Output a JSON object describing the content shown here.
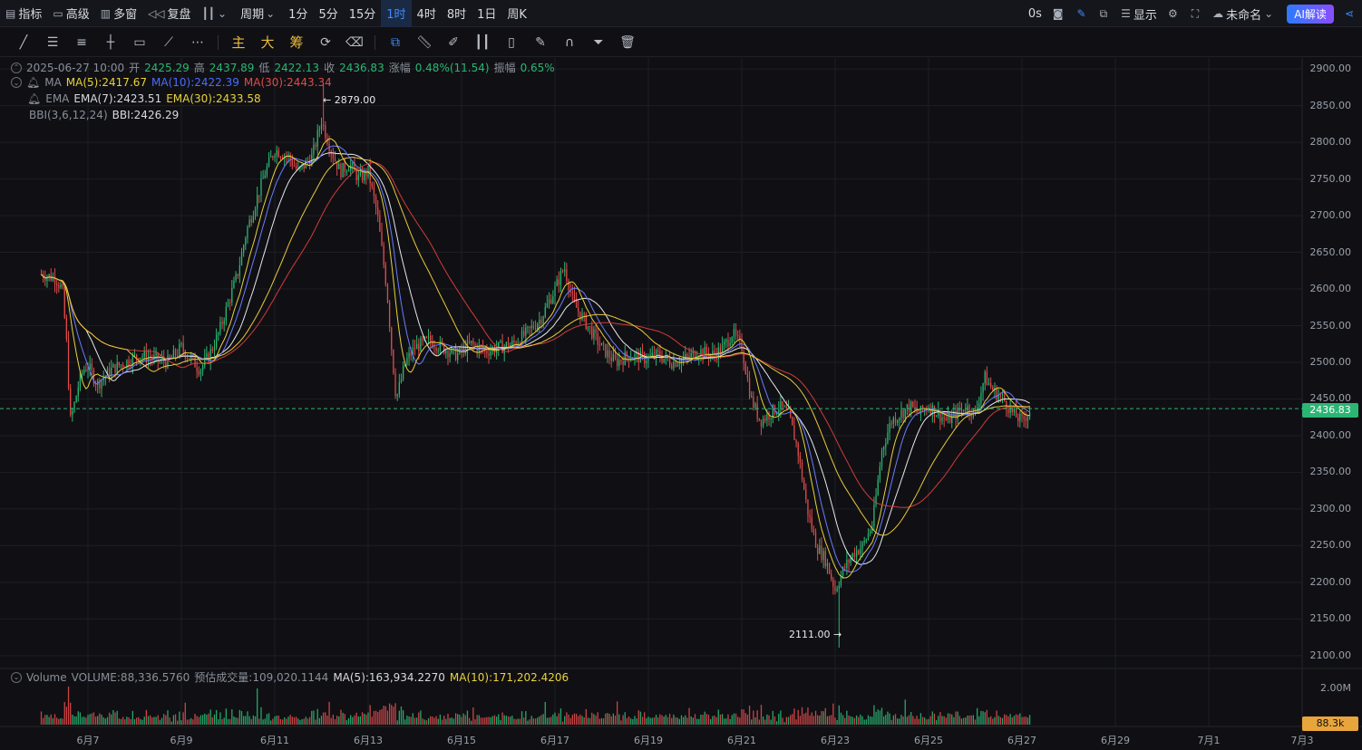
{
  "topbar": {
    "indicators": "指标",
    "advanced": "高级",
    "multiwindow": "多窗",
    "replay": "复盘",
    "period": "周期",
    "intervals": [
      "1分",
      "5分",
      "15分",
      "1时",
      "4时",
      "8时",
      "1日",
      "周K"
    ],
    "active_interval": "1时",
    "latency": "0s",
    "display": "显示",
    "layout_name": "未命名",
    "ai": "AI解读"
  },
  "drawing_tools": {
    "main": "主",
    "big": "大",
    "chip": "筹"
  },
  "ohlc": {
    "datetime": "2025-06-27 10:00",
    "open_label": "开",
    "open": "2425.29",
    "high_label": "高",
    "high": "2437.89",
    "low_label": "低",
    "low": "2422.13",
    "close_label": "收",
    "close": "2436.83",
    "change_label": "涨幅",
    "change": "0.48%(11.54)",
    "amp_label": "振幅",
    "amp": "0.65%"
  },
  "ma": {
    "name": "MA",
    "ma5": "MA(5):2417.67",
    "ma10": "MA(10):2422.39",
    "ma30": "MA(30):2443.34"
  },
  "ema": {
    "name": "EMA",
    "ema7": "EMA(7):2423.51",
    "ema30": "EMA(30):2433.58"
  },
  "bbi": {
    "name": "BBI(3,6,12,24)",
    "value": "BBI:2426.29"
  },
  "volume": {
    "name": "Volume",
    "vol": "VOLUME:88,336.5760",
    "est": "预估成交量:109,020.1144",
    "ma5": "MA(5):163,934.2270",
    "ma10": "MA(10):171,202.4206",
    "axis_top": "2.00M",
    "current": "88.3k"
  },
  "annotations": {
    "high": "← 2879.00",
    "low": "2111.00 →"
  },
  "current_price": "2436.83",
  "chart_data": {
    "type": "candlestick",
    "y_ticks": [
      "2900.00",
      "2850.00",
      "2800.00",
      "2750.00",
      "2700.00",
      "2650.00",
      "2600.00",
      "2550.00",
      "2500.00",
      "2450.00",
      "2400.00",
      "2350.00",
      "2300.00",
      "2250.00",
      "2200.00",
      "2150.00",
      "2100.00"
    ],
    "ylim": [
      2085,
      2915
    ],
    "x_ticks": [
      "6月7",
      "6月9",
      "6月11",
      "6月13",
      "6月15",
      "6月17",
      "6月19",
      "6月21",
      "6月23",
      "6月25",
      "6月27",
      "6月29",
      "7月1",
      "7月3"
    ],
    "x_range_days": [
      6.0,
      7.6
    ],
    "close_path": [
      [
        6.0,
        2620
      ],
      [
        6.3,
        2615
      ],
      [
        6.45,
        2600
      ],
      [
        6.55,
        2520
      ],
      [
        6.62,
        2420
      ],
      [
        6.7,
        2440
      ],
      [
        6.8,
        2470
      ],
      [
        6.9,
        2490
      ],
      [
        7.0,
        2495
      ],
      [
        7.2,
        2470
      ],
      [
        7.5,
        2490
      ],
      [
        7.8,
        2500
      ],
      [
        8.1,
        2510
      ],
      [
        8.4,
        2505
      ],
      [
        8.7,
        2500
      ],
      [
        9.0,
        2520
      ],
      [
        9.2,
        2505
      ],
      [
        9.4,
        2490
      ],
      [
        9.6,
        2510
      ],
      [
        9.8,
        2540
      ],
      [
        10.0,
        2580
      ],
      [
        10.2,
        2620
      ],
      [
        10.4,
        2680
      ],
      [
        10.6,
        2720
      ],
      [
        10.8,
        2760
      ],
      [
        11.0,
        2790
      ],
      [
        11.3,
        2780
      ],
      [
        11.5,
        2760
      ],
      [
        11.8,
        2780
      ],
      [
        12.0,
        2830
      ],
      [
        12.2,
        2790
      ],
      [
        12.4,
        2760
      ],
      [
        12.6,
        2770
      ],
      [
        12.8,
        2750
      ],
      [
        13.0,
        2760
      ],
      [
        13.2,
        2700
      ],
      [
        13.4,
        2600
      ],
      [
        13.5,
        2520
      ],
      [
        13.6,
        2450
      ],
      [
        13.8,
        2500
      ],
      [
        14.0,
        2520
      ],
      [
        14.3,
        2530
      ],
      [
        14.6,
        2520
      ],
      [
        14.9,
        2510
      ],
      [
        15.2,
        2525
      ],
      [
        15.5,
        2515
      ],
      [
        15.8,
        2520
      ],
      [
        16.1,
        2525
      ],
      [
        16.4,
        2540
      ],
      [
        16.7,
        2560
      ],
      [
        17.0,
        2600
      ],
      [
        17.2,
        2630
      ],
      [
        17.4,
        2580
      ],
      [
        17.6,
        2560
      ],
      [
        17.8,
        2540
      ],
      [
        18.0,
        2520
      ],
      [
        18.3,
        2500
      ],
      [
        18.6,
        2510
      ],
      [
        18.9,
        2505
      ],
      [
        19.2,
        2510
      ],
      [
        19.5,
        2500
      ],
      [
        19.8,
        2505
      ],
      [
        20.1,
        2515
      ],
      [
        20.4,
        2510
      ],
      [
        20.6,
        2520
      ],
      [
        20.8,
        2540
      ],
      [
        21.0,
        2520
      ],
      [
        21.2,
        2450
      ],
      [
        21.4,
        2420
      ],
      [
        21.6,
        2430
      ],
      [
        21.8,
        2440
      ],
      [
        22.0,
        2430
      ],
      [
        22.2,
        2380
      ],
      [
        22.4,
        2300
      ],
      [
        22.6,
        2250
      ],
      [
        22.8,
        2230
      ],
      [
        23.0,
        2190
      ],
      [
        23.2,
        2220
      ],
      [
        23.4,
        2240
      ],
      [
        23.6,
        2250
      ],
      [
        23.8,
        2280
      ],
      [
        24.0,
        2380
      ],
      [
        24.2,
        2420
      ],
      [
        24.4,
        2430
      ],
      [
        24.6,
        2440
      ],
      [
        24.8,
        2430
      ],
      [
        25.0,
        2440
      ],
      [
        25.2,
        2430
      ],
      [
        25.4,
        2420
      ],
      [
        25.6,
        2430
      ],
      [
        25.8,
        2440
      ],
      [
        26.0,
        2430
      ],
      [
        26.2,
        2480
      ],
      [
        26.4,
        2460
      ],
      [
        26.6,
        2450
      ],
      [
        26.8,
        2430
      ],
      [
        27.0,
        2420
      ],
      [
        27.2,
        2436.83
      ]
    ],
    "extremes": {
      "high": 2879.0,
      "low": 2111.0
    }
  },
  "colors": {
    "up": "#2bb673",
    "down": "#e04a4a",
    "ma5": "#e8d23b",
    "ma10": "#6a7cff",
    "ma30": "#d03b3b",
    "white_line": "#e6e8ec",
    "accent": "#3d8bff",
    "volume_tag": "#e8a53b"
  }
}
